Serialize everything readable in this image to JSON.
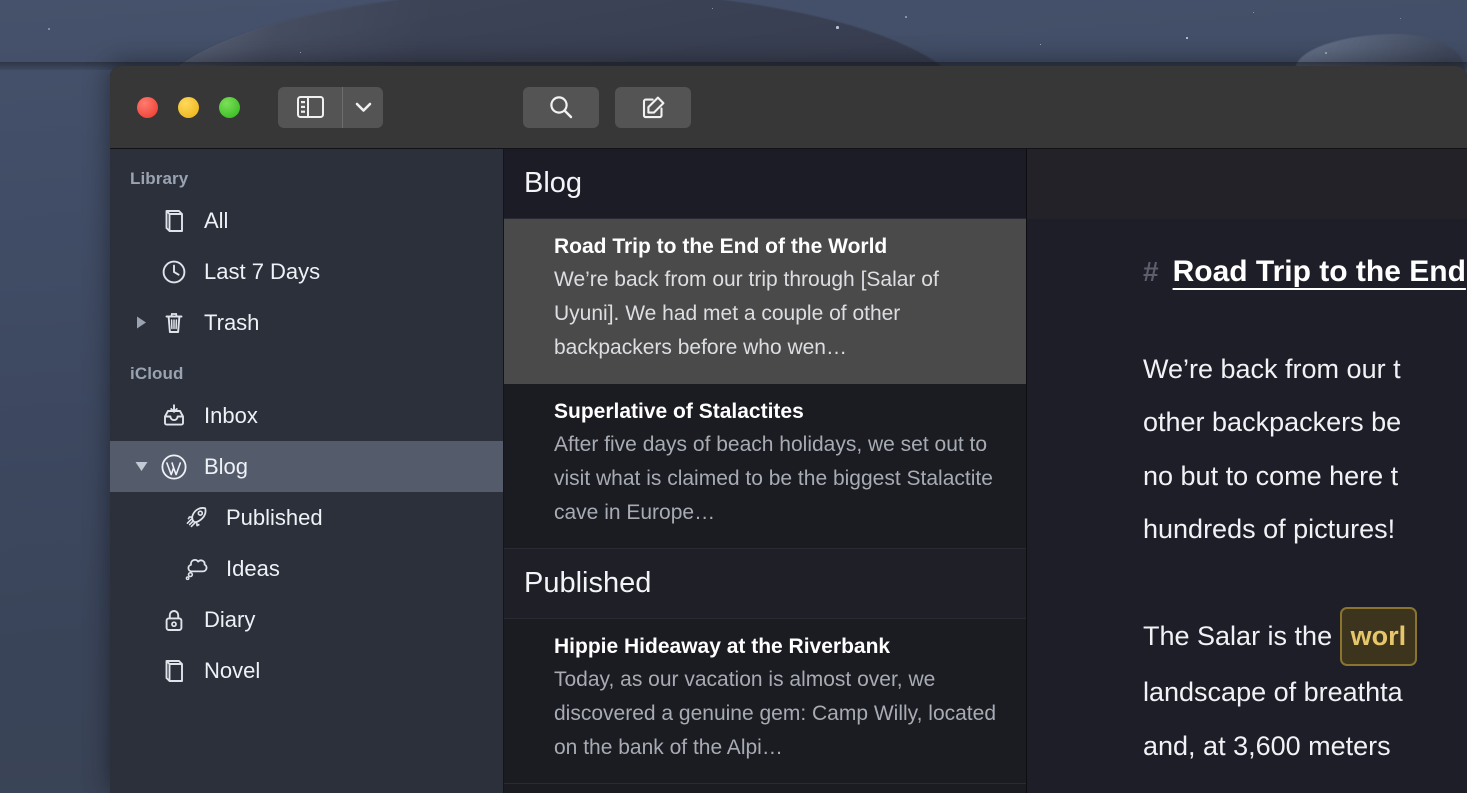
{
  "window": {
    "traffic_lights": [
      {
        "name": "close",
        "color": "#f24b3f"
      },
      {
        "name": "minimize",
        "color": "#f0bb27"
      },
      {
        "name": "maximize",
        "color": "#45c22c"
      }
    ]
  },
  "toolbar": {
    "sidebar_toggle_icon": "sidebar-toggle-icon",
    "sidebar_chevron_icon": "chevron-down-icon",
    "search_icon": "search-icon",
    "compose_icon": "compose-icon"
  },
  "sidebar": {
    "groups": [
      {
        "title": "Library",
        "items": [
          {
            "label": "All",
            "icon": "book-icon",
            "disclosure": "none",
            "selected": false,
            "indent": 1
          },
          {
            "label": "Last 7 Days",
            "icon": "clock-icon",
            "disclosure": "none",
            "selected": false,
            "indent": 1
          },
          {
            "label": "Trash",
            "icon": "trash-icon",
            "disclosure": "collapsed",
            "selected": false,
            "indent": 1
          }
        ]
      },
      {
        "title": "iCloud",
        "items": [
          {
            "label": "Inbox",
            "icon": "inbox-icon",
            "disclosure": "none",
            "selected": false,
            "indent": 1
          },
          {
            "label": "Blog",
            "icon": "wordpress-icon",
            "disclosure": "expanded",
            "selected": true,
            "indent": 1
          },
          {
            "label": "Published",
            "icon": "rocket-icon",
            "disclosure": "none",
            "selected": false,
            "indent": 2
          },
          {
            "label": "Ideas",
            "icon": "thought-bubble-icon",
            "disclosure": "none",
            "selected": false,
            "indent": 2
          },
          {
            "label": "Diary",
            "icon": "lock-icon",
            "disclosure": "none",
            "selected": false,
            "indent": 1
          },
          {
            "label": "Novel",
            "icon": "book-icon",
            "disclosure": "none",
            "selected": false,
            "indent": 1
          }
        ]
      }
    ]
  },
  "note_list": {
    "header": "Blog",
    "sections": [
      {
        "header": null,
        "notes": [
          {
            "title": "Road Trip to the End of the World",
            "preview": "We’re back from our trip through [Salar of Uyuni]. We had met a couple of other backpackers before who wen…",
            "selected": true
          },
          {
            "title": "Superlative of Stalactites",
            "preview": "After five days of beach holidays, we set out to visit what is claimed to be the biggest Stalactite cave in Europe…",
            "selected": false
          }
        ]
      },
      {
        "header": "Published",
        "notes": [
          {
            "title": "Hippie Hideaway at the Riverbank",
            "preview": "Today, as our vacation is almost over, we discovered a genuine gem: Camp Willy, located on the bank of the Alpi…",
            "selected": false
          }
        ]
      }
    ]
  },
  "editor": {
    "heading_marker": "#",
    "heading": "Road Trip to the End",
    "paragraphs": [
      "We’re back from our t",
      "other backpackers be",
      "no but to come here t",
      "hundreds of pictures!"
    ],
    "paragraph2_pre": "The Salar is the ",
    "paragraph2_tag": "worl",
    "paragraph2_lines": [
      "landscape of breathta",
      "and, at 3,600 meters"
    ]
  },
  "colors": {
    "accent_tag_text": "#e6c66a",
    "accent_tag_bg": "#3c341c",
    "accent_tag_border": "#8a7430",
    "sidebar_bg": "#2b303a",
    "sidebar_selected": "#545b6b",
    "list_bg": "#1b1b22",
    "list_selected": "#4a4a4a",
    "editor_bg": "#1e1e28",
    "toolbar_bg": "#373737"
  }
}
